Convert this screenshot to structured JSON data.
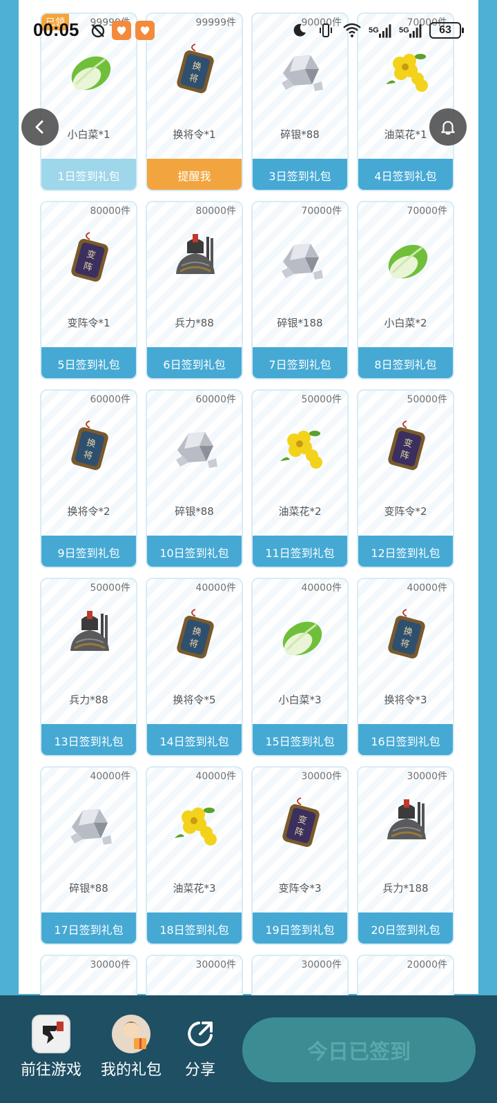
{
  "status_bar": {
    "time": "00:05",
    "battery": "63",
    "net1": "5G",
    "net2": "5G"
  },
  "cards": [
    {
      "stock": "99999件",
      "tag": "已领",
      "item": "小白菜*1",
      "button": "1日签到礼包",
      "state": "claimed",
      "icon": "cabbage-icon"
    },
    {
      "stock": "99999件",
      "item": "换将令*1",
      "button": "提醒我",
      "state": "remind",
      "icon": "token-huanjiang-icon"
    },
    {
      "stock": "90000件",
      "item": "碎银*88",
      "button": "3日签到礼包",
      "state": "normal",
      "icon": "silver-icon"
    },
    {
      "stock": "70000件",
      "item": "油菜花*1",
      "button": "4日签到礼包",
      "state": "normal",
      "icon": "flower-icon"
    },
    {
      "stock": "80000件",
      "item": "变阵令*1",
      "button": "5日签到礼包",
      "state": "normal",
      "icon": "token-bianzhen-icon"
    },
    {
      "stock": "80000件",
      "item": "兵力*88",
      "button": "6日签到礼包",
      "state": "normal",
      "icon": "armor-icon"
    },
    {
      "stock": "70000件",
      "item": "碎银*188",
      "button": "7日签到礼包",
      "state": "normal",
      "icon": "silver-icon"
    },
    {
      "stock": "70000件",
      "item": "小白菜*2",
      "button": "8日签到礼包",
      "state": "normal",
      "icon": "cabbage-icon"
    },
    {
      "stock": "60000件",
      "item": "换将令*2",
      "button": "9日签到礼包",
      "state": "normal",
      "icon": "token-huanjiang-icon"
    },
    {
      "stock": "60000件",
      "item": "碎银*88",
      "button": "10日签到礼包",
      "state": "normal",
      "icon": "silver-icon"
    },
    {
      "stock": "50000件",
      "item": "油菜花*2",
      "button": "11日签到礼包",
      "state": "normal",
      "icon": "flower-icon"
    },
    {
      "stock": "50000件",
      "item": "变阵令*2",
      "button": "12日签到礼包",
      "state": "normal",
      "icon": "token-bianzhen-icon"
    },
    {
      "stock": "50000件",
      "item": "兵力*88",
      "button": "13日签到礼包",
      "state": "normal",
      "icon": "armor-icon"
    },
    {
      "stock": "40000件",
      "item": "换将令*5",
      "button": "14日签到礼包",
      "state": "normal",
      "icon": "token-huanjiang-icon"
    },
    {
      "stock": "40000件",
      "item": "小白菜*3",
      "button": "15日签到礼包",
      "state": "normal",
      "icon": "cabbage-icon"
    },
    {
      "stock": "40000件",
      "item": "换将令*3",
      "button": "16日签到礼包",
      "state": "normal",
      "icon": "token-huanjiang-icon"
    },
    {
      "stock": "40000件",
      "item": "碎银*88",
      "button": "17日签到礼包",
      "state": "normal",
      "icon": "silver-icon"
    },
    {
      "stock": "40000件",
      "item": "油菜花*3",
      "button": "18日签到礼包",
      "state": "normal",
      "icon": "flower-icon"
    },
    {
      "stock": "30000件",
      "item": "变阵令*3",
      "button": "19日签到礼包",
      "state": "normal",
      "icon": "token-bianzhen-icon"
    },
    {
      "stock": "30000件",
      "item": "兵力*188",
      "button": "20日签到礼包",
      "state": "normal",
      "icon": "armor-icon"
    },
    {
      "stock": "30000件",
      "partial": true
    },
    {
      "stock": "30000件",
      "partial": true
    },
    {
      "stock": "30000件",
      "partial": true
    },
    {
      "stock": "20000件",
      "partial": true
    }
  ],
  "bottom_bar": {
    "game_label": "前往游戏",
    "gifts_label": "我的礼包",
    "share_label": "分享",
    "signed_label": "今日已签到"
  },
  "colors": {
    "accent": "#46a9d4",
    "claimed": "#9ed6ea",
    "remind": "#f2a53e",
    "bottom_bar": "#1f4f63"
  }
}
